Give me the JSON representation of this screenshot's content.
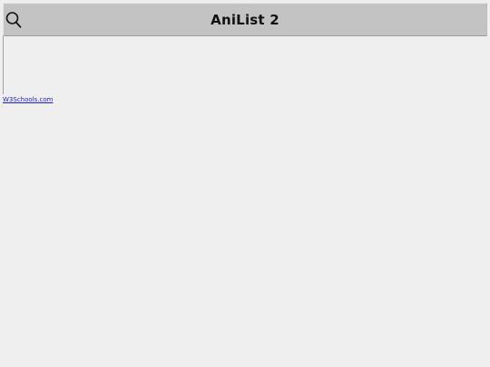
{
  "header": {
    "title": "AniList 2",
    "search_icon": "search-icon"
  },
  "footer": {
    "link_text": "W3Schools.com"
  },
  "colors": {
    "background": "#efefef",
    "header_bg": "#c3c3c3",
    "link": "#1d1dcf"
  }
}
